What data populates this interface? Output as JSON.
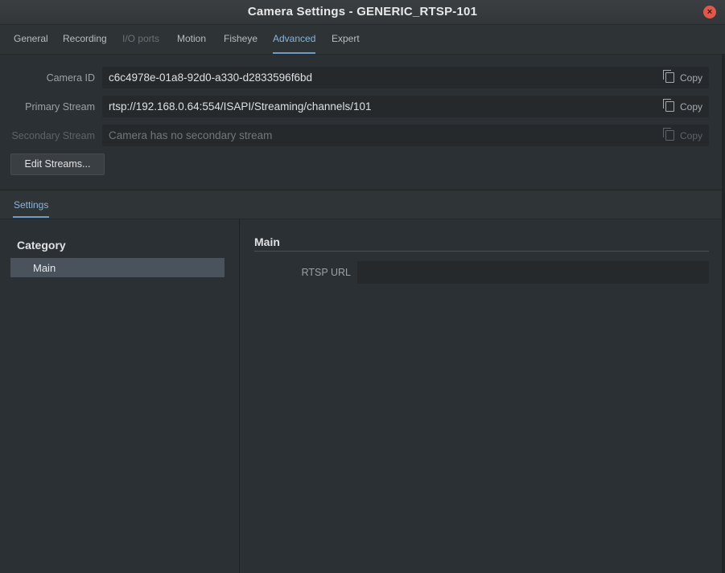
{
  "window": {
    "title": "Camera Settings - GENERIC_RTSP-101",
    "close_glyph": "×"
  },
  "tabs": [
    {
      "label": "General",
      "state": "normal"
    },
    {
      "label": "Recording",
      "state": "normal"
    },
    {
      "label": "I/O ports",
      "state": "disabled"
    },
    {
      "label": "Motion",
      "state": "normal"
    },
    {
      "label": "Fisheye",
      "state": "normal"
    },
    {
      "label": "Advanced",
      "state": "active"
    },
    {
      "label": "Expert",
      "state": "normal"
    }
  ],
  "fields": {
    "camera_id": {
      "label": "Camera ID",
      "value": "c6c4978e-01a8-92d0-a330-d2833596f6bd",
      "copy_label": "Copy"
    },
    "primary_stream": {
      "label": "Primary Stream",
      "value": "rtsp://192.168.0.64:554/ISAPI/Streaming/channels/101",
      "copy_label": "Copy"
    },
    "secondary_stream": {
      "label": "Secondary Stream",
      "value": "Camera has no secondary stream",
      "copy_label": "Copy",
      "disabled": true
    }
  },
  "edit_streams_label": "Edit Streams...",
  "settings_tab": "Settings",
  "category": {
    "header": "Category",
    "items": [
      {
        "label": "Main",
        "selected": true
      }
    ]
  },
  "main": {
    "header": "Main",
    "rtsp_label": "RTSP URL",
    "rtsp_value": ""
  },
  "colors": {
    "accent": "#8db3d8",
    "background": "#2b3034",
    "selection": "#4a535b",
    "close": "#e0584b"
  }
}
